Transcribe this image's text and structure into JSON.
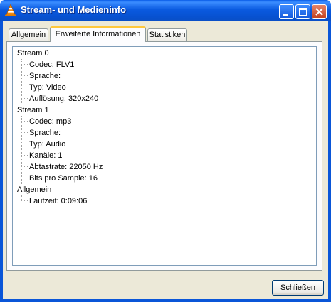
{
  "window": {
    "title": "Stream- und Medieninfo",
    "accent_color": "#0a56d8",
    "icon": "vlc-cone-icon"
  },
  "tabs": [
    {
      "label": "Allgemein",
      "selected": false
    },
    {
      "label": "Erweiterte Informationen",
      "selected": true
    },
    {
      "label": "Statistiken",
      "selected": false
    }
  ],
  "tree": [
    {
      "label": "Stream 0",
      "children": [
        "Codec: FLV1",
        "Sprache:",
        "Typ: Video",
        "Auflösung: 320x240"
      ]
    },
    {
      "label": "Stream 1",
      "children": [
        "Codec: mp3",
        "Sprache:",
        "Typ: Audio",
        "Kanäle: 1",
        "Abtastrate: 22050 Hz",
        "Bits pro Sample: 16"
      ]
    },
    {
      "label": "Allgemein",
      "children": [
        "Laufzeit: 0:09:06"
      ]
    }
  ],
  "buttons": {
    "close_label": "Schließen",
    "close_mnemonic": "c"
  }
}
